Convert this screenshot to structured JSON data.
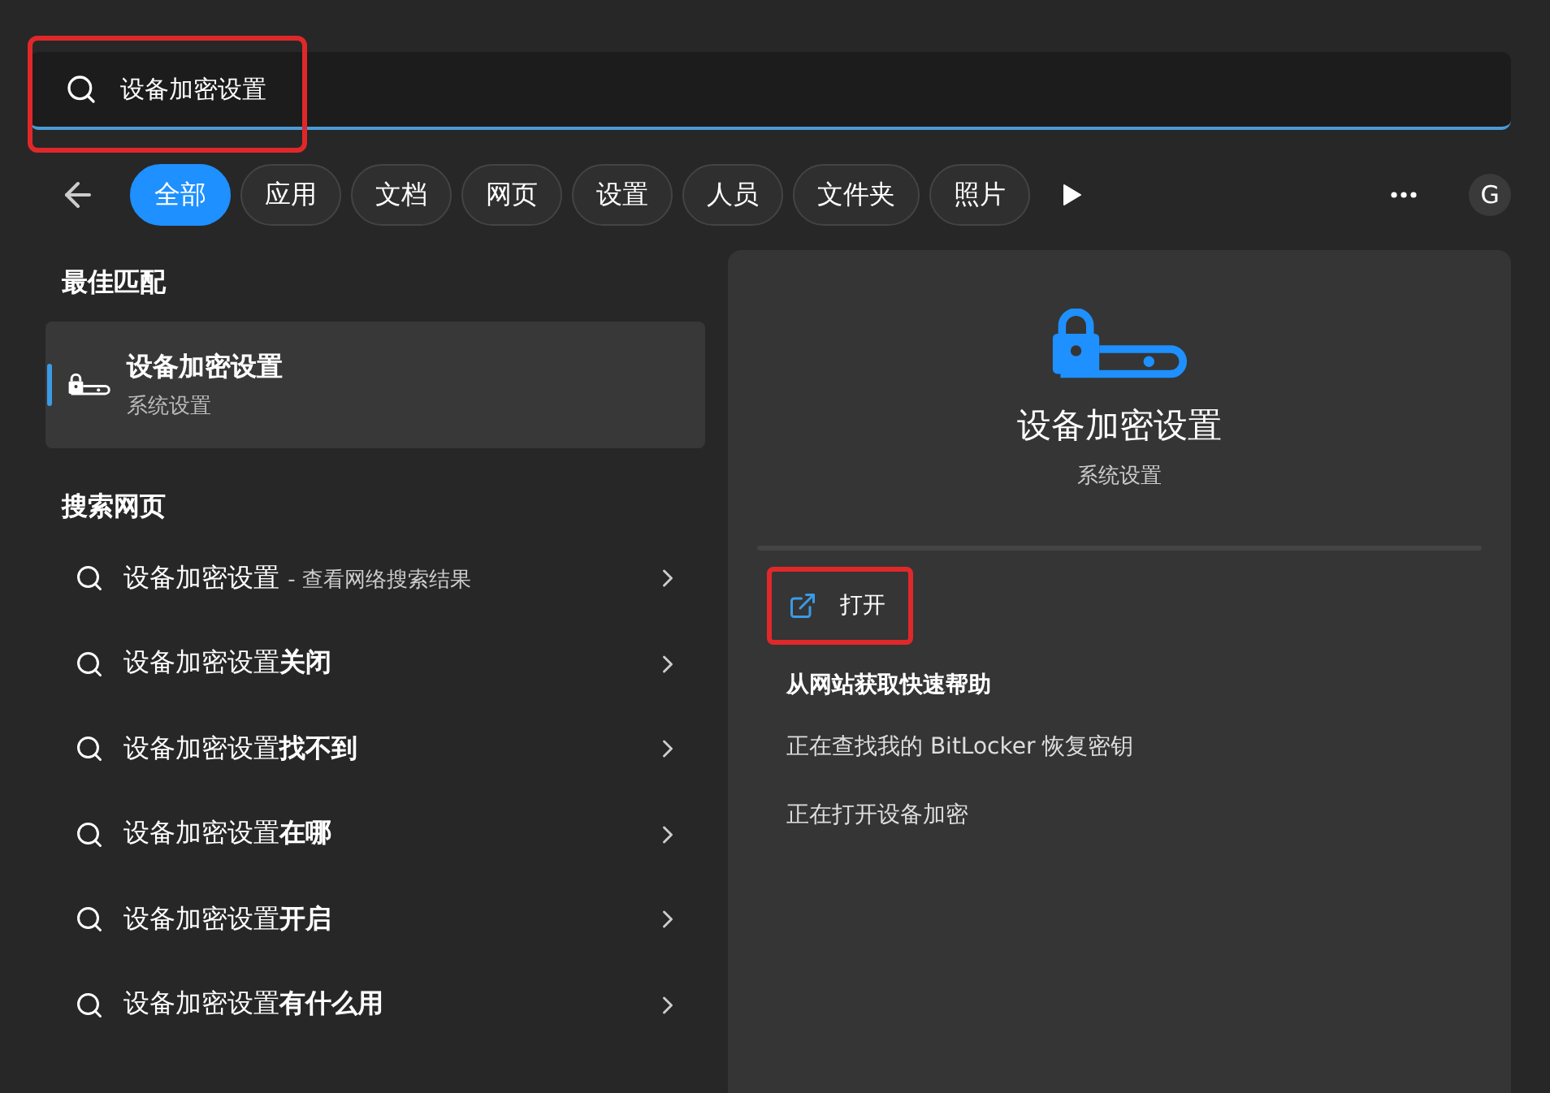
{
  "search": {
    "value": "设备加密设置",
    "highlighted": true
  },
  "filters": [
    {
      "label": "全部",
      "selected": true
    },
    {
      "label": "应用",
      "selected": false
    },
    {
      "label": "文档",
      "selected": false
    },
    {
      "label": "网页",
      "selected": false
    },
    {
      "label": "设置",
      "selected": false
    },
    {
      "label": "人员",
      "selected": false
    },
    {
      "label": "文件夹",
      "selected": false
    },
    {
      "label": "照片",
      "selected": false
    }
  ],
  "account_initial": "G",
  "best_match": {
    "heading": "最佳匹配",
    "title": "设备加密设置",
    "subtitle": "系统设置",
    "selected": true
  },
  "web_search": {
    "heading": "搜索网页",
    "items": [
      {
        "text": "设备加密设置",
        "note": "- 查看网络搜索结果"
      },
      {
        "text": "设备加密设置**关闭**"
      },
      {
        "text": "设备加密设置**找不到**"
      },
      {
        "text": "设备加密设置**在哪**"
      },
      {
        "text": "设备加密设置**开启**"
      },
      {
        "text": "设备加密设置**有什么用**"
      }
    ]
  },
  "details": {
    "title": "设备加密设置",
    "subtitle": "系统设置",
    "actions": [
      {
        "kind": "open",
        "label": "打开",
        "highlighted": true
      },
      {
        "kind": "heading",
        "label": "从网站获取快速帮助"
      },
      {
        "kind": "link",
        "label": "正在查找我的 BitLocker 恢复密钥"
      },
      {
        "kind": "link",
        "label": "正在打开设备加密"
      }
    ]
  }
}
